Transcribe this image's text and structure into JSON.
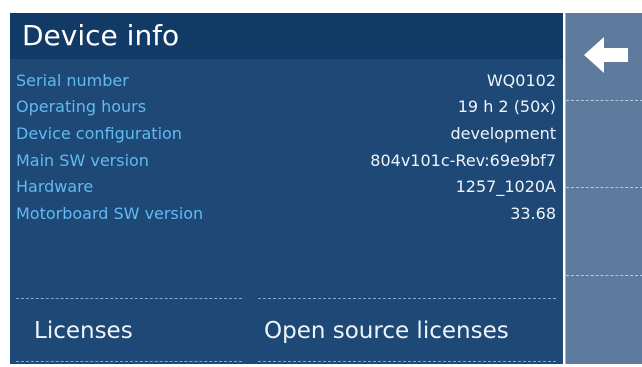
{
  "header": {
    "title": "Device info"
  },
  "info": {
    "rows": [
      {
        "label": "Serial number",
        "value": "WQ0102"
      },
      {
        "label": "Operating hours",
        "value": "19 h 2 (50x)"
      },
      {
        "label": "Device configuration",
        "value": "development"
      },
      {
        "label": "Main SW version",
        "value": "804v101c-Rev:69e9bf7"
      },
      {
        "label": "Hardware",
        "value": "1257_1020A"
      },
      {
        "label": "Motorboard SW version",
        "value": "33.68"
      }
    ]
  },
  "buttons": {
    "licenses": "Licenses",
    "open_source_licenses": "Open source licenses"
  },
  "sidebar": {
    "back_icon": "arrow-left-icon"
  },
  "colors": {
    "panel": "#1e4876",
    "header": "#123a66",
    "label": "#63b9f2",
    "value": "#eef4fa",
    "sidebar": "#5e7a9c"
  }
}
